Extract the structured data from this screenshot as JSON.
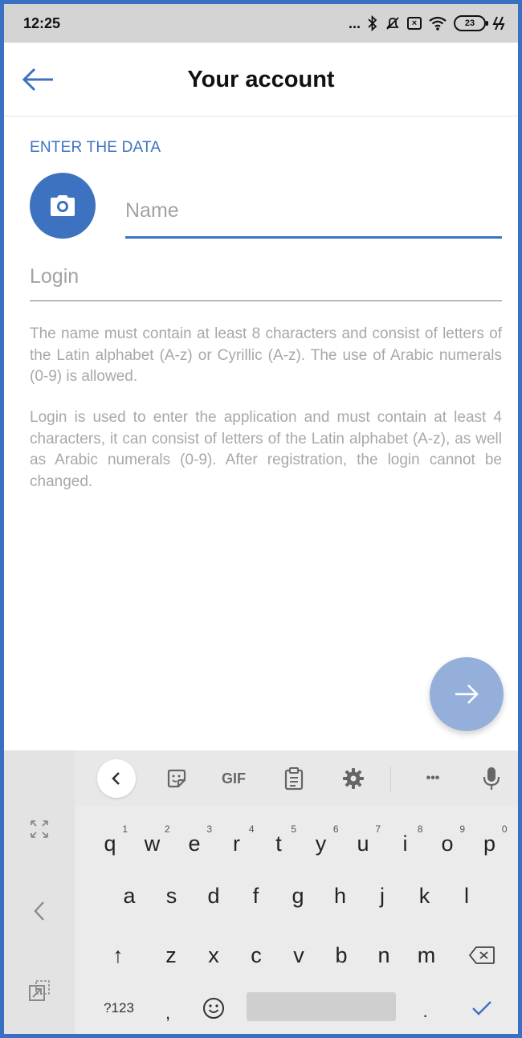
{
  "status_bar": {
    "time": "12:25",
    "dots": "...",
    "battery": "23"
  },
  "app_bar": {
    "title": "Your account"
  },
  "form": {
    "section_label": "ENTER THE DATA",
    "name_placeholder": "Name",
    "name_value": "",
    "login_placeholder": "Login",
    "login_value": "",
    "name_hint": "The name must contain at least 8 characters and consist of letters of the Latin alphabet (A-z) or Cyrillic (A-z). The use of Arabic numerals (0-9) is allowed.",
    "login_hint": "Login is used to enter the application and must contain at least 4 characters, it can consist of letters of the Latin alphabet (A-z), as well as Arabic numerals (0-9). After registration, the login cannot be changed."
  },
  "keyboard": {
    "toolbar": {
      "gif_label": "GIF",
      "more_label": "•••"
    },
    "row1": [
      {
        "key": "q",
        "num": "1"
      },
      {
        "key": "w",
        "num": "2"
      },
      {
        "key": "e",
        "num": "3"
      },
      {
        "key": "r",
        "num": "4"
      },
      {
        "key": "t",
        "num": "5"
      },
      {
        "key": "y",
        "num": "6"
      },
      {
        "key": "u",
        "num": "7"
      },
      {
        "key": "i",
        "num": "8"
      },
      {
        "key": "o",
        "num": "9"
      },
      {
        "key": "p",
        "num": "0"
      }
    ],
    "row2": [
      "a",
      "s",
      "d",
      "f",
      "g",
      "h",
      "j",
      "k",
      "l"
    ],
    "row3": [
      "z",
      "x",
      "c",
      "v",
      "b",
      "n",
      "m"
    ],
    "shift_label": "↑",
    "symbols_label": "?123",
    "comma_label": ",",
    "period_label": ".",
    "colors": {
      "accent": "#3d72c0",
      "fab": "#94b0da",
      "check": "#3d72c0"
    }
  }
}
